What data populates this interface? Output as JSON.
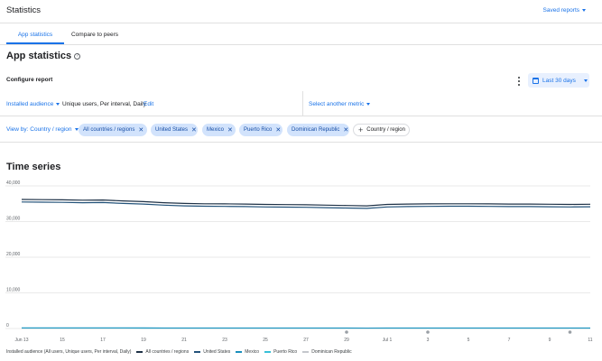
{
  "header": {
    "title": "Statistics",
    "saved_reports": "Saved reports"
  },
  "tabs": [
    {
      "label": "App statistics",
      "active": true
    },
    {
      "label": "Compare to peers",
      "active": false
    }
  ],
  "section": {
    "title": "App statistics",
    "help_icon": "help-circle-icon"
  },
  "configure": {
    "label": "Configure report",
    "more_icon": "more-vert-icon",
    "date_icon": "calendar-icon",
    "date_range": "Last 30 days"
  },
  "metric": {
    "dropdown": "Installed audience",
    "description": "Unique users, Per interval, Daily",
    "edit": "Edit",
    "another": "Select another metric"
  },
  "filters": {
    "view_by": "View by: Country / region",
    "chips": [
      "All countries / regions",
      "United States",
      "Mexico",
      "Puerto Rico",
      "Dominican Republic"
    ],
    "add_label": "Country / region"
  },
  "timeseries": {
    "title": "Time series"
  },
  "colors": {
    "accent": "#1a73e8",
    "chip_bg": "#d2e3fc",
    "all_countries": "#1f3247",
    "united_states": "#24537a",
    "mexico": "#1a8fbd",
    "puerto_rico": "#38c0d8",
    "dominican_republic": "#c4c7cc"
  },
  "chart_data": {
    "type": "line",
    "x": [
      "Jun 13",
      "Jun 14",
      "Jun 15",
      "Jun 16",
      "Jun 17",
      "Jun 18",
      "Jun 19",
      "Jun 20",
      "Jun 21",
      "Jun 22",
      "Jun 23",
      "Jun 24",
      "Jun 25",
      "Jun 26",
      "Jun 27",
      "Jun 28",
      "Jun 29",
      "Jun 30",
      "Jul 1",
      "Jul 2",
      "Jul 3",
      "Jul 4",
      "Jul 5",
      "Jul 6",
      "Jul 7",
      "Jul 8",
      "Jul 9",
      "Jul 10",
      "Jul 11"
    ],
    "x_ticks": [
      "Jun 13",
      "15",
      "17",
      "19",
      "21",
      "23",
      "25",
      "27",
      "29",
      "Jul 1",
      "3",
      "5",
      "7",
      "9",
      "11"
    ],
    "y_ticks": [
      "40,000",
      "30,000",
      "20,000",
      "10,000",
      "0"
    ],
    "ylim": [
      0,
      40000
    ],
    "series": [
      {
        "name": "All countries / regions",
        "values": [
          36200,
          36150,
          36100,
          36000,
          36050,
          35800,
          35600,
          35300,
          35100,
          35000,
          34950,
          34900,
          34800,
          34750,
          34700,
          34600,
          34500,
          34400,
          34800,
          34900,
          34950,
          35000,
          35000,
          34950,
          34900,
          34900,
          34850,
          34800,
          34850
        ]
      },
      {
        "name": "United States",
        "values": [
          35500,
          35450,
          35400,
          35300,
          35350,
          35100,
          34900,
          34600,
          34400,
          34300,
          34250,
          34200,
          34100,
          34050,
          34000,
          33900,
          33800,
          33700,
          34100,
          34200,
          34250,
          34300,
          34300,
          34250,
          34200,
          34200,
          34150,
          34100,
          34150
        ]
      },
      {
        "name": "Mexico",
        "values": [
          180,
          180,
          175,
          170,
          175,
          170,
          165,
          160,
          158,
          155,
          155,
          150,
          150,
          148,
          145,
          142,
          140,
          138,
          145,
          148,
          150,
          152,
          150,
          148,
          146,
          145,
          144,
          142,
          143
        ]
      },
      {
        "name": "Puerto Rico",
        "values": [
          120,
          118,
          117,
          115,
          116,
          114,
          112,
          110,
          108,
          107,
          106,
          105,
          104,
          103,
          102,
          100,
          99,
          98,
          102,
          104,
          105,
          106,
          105,
          104,
          103,
          102,
          101,
          100,
          101
        ]
      },
      {
        "name": "Dominican Republic",
        "values": [
          60,
          60,
          59,
          58,
          59,
          58,
          57,
          56,
          55,
          55,
          54,
          54,
          53,
          53,
          52,
          52,
          51,
          50,
          52,
          53,
          53,
          54,
          54,
          53,
          53,
          52,
          52,
          51,
          52
        ]
      }
    ],
    "markers": [
      {
        "x": "Jun 29",
        "y": 0
      },
      {
        "x": "Jul 3",
        "y": 0
      },
      {
        "x": "Jul 10",
        "y": 0
      }
    ],
    "legend_prefix": "Installed audience (All users, Unique users, Per interval, Daily)",
    "legend_position": "bottom-left",
    "grid": true
  }
}
